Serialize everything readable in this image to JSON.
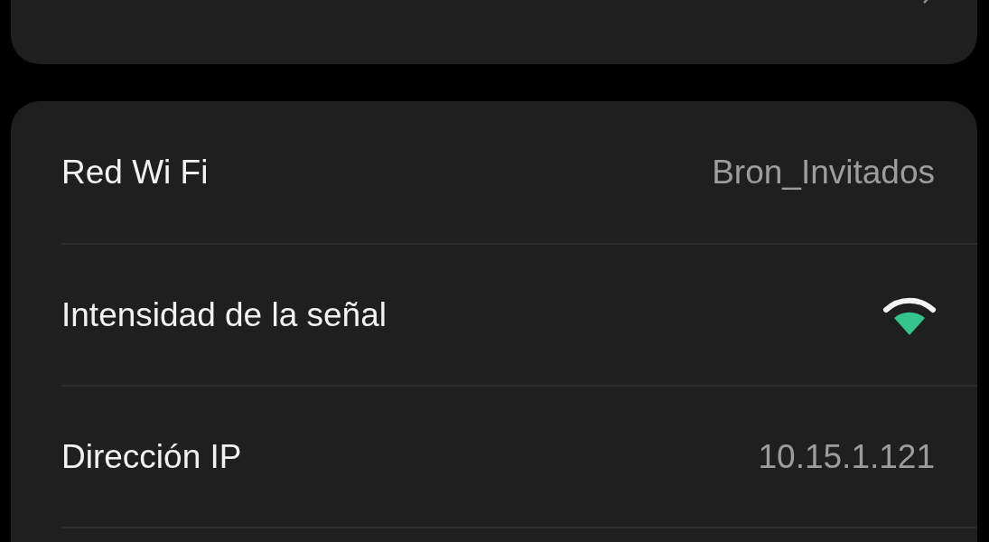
{
  "cards": [
    {
      "rows": [
        {
          "kind": "link"
        }
      ]
    },
    {
      "rows": [
        {
          "kind": "text",
          "label": "Red Wi Fi",
          "value": "Bron_Invitados"
        },
        {
          "kind": "signal",
          "label": "Intensidad de la señal"
        },
        {
          "kind": "text",
          "label": "Dirección IP",
          "value": "10.15.1.121"
        },
        {
          "kind": "text"
        }
      ]
    }
  ]
}
